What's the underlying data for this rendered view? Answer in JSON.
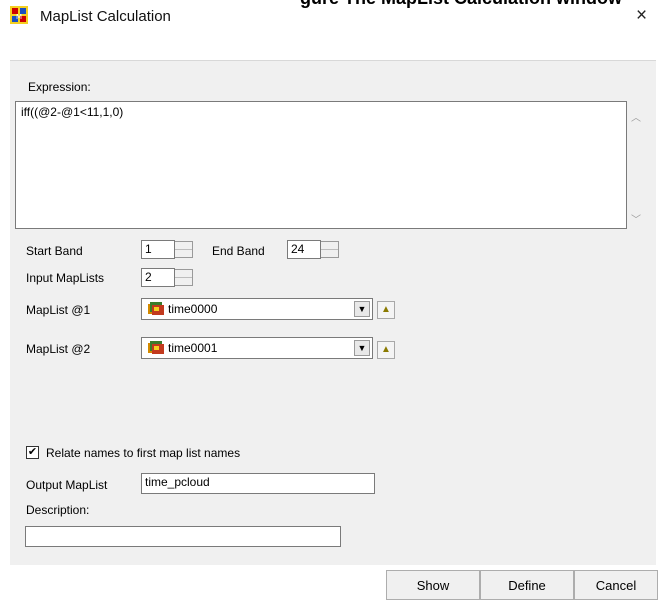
{
  "window": {
    "caption_fragment": "gure  The MapList Calculation window",
    "title": "MapList Calculation",
    "close_glyph": "×",
    "app_icon": "ilwis-app-icon"
  },
  "expression": {
    "label": "Expression:",
    "value": "iff((@2-@1<11,1,0)"
  },
  "bands": {
    "start_label": "Start Band",
    "start_value": "1",
    "end_label": "End Band",
    "end_value": "24"
  },
  "input_maplists": {
    "label": "Input MapLists",
    "value": "2"
  },
  "maplists": [
    {
      "label": "MapList @1",
      "value": "time0000",
      "icon": "maplist-icon"
    },
    {
      "label": "MapList @2",
      "value": "time0001",
      "icon": "maplist-icon"
    }
  ],
  "relate": {
    "checked": true,
    "check_glyph": "✔",
    "label": "Relate names to first map list names"
  },
  "output": {
    "label": "Output MapList",
    "value": "time_pcloud"
  },
  "description": {
    "label": "Description:",
    "value": ""
  },
  "buttons": {
    "show": "Show",
    "define": "Define",
    "cancel": "Cancel"
  },
  "colors": {
    "panel_bg": "#f0f0f0",
    "field_border": "#7a7a7a"
  }
}
